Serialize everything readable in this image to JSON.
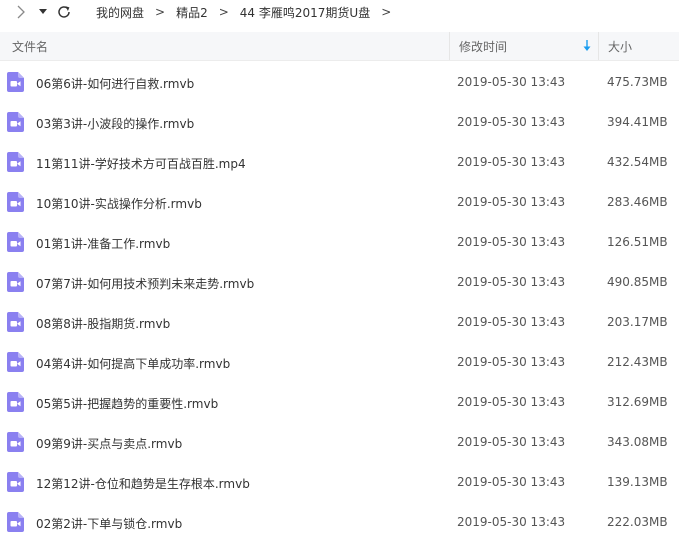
{
  "breadcrumb": [
    "我的网盘",
    "精品2",
    "44 李雁鸣2017期货U盘"
  ],
  "breadcrumb_separator": ">",
  "columns": {
    "name": "文件名",
    "modified": "修改时间",
    "size": "大小"
  },
  "colors": {
    "accent": "#1a9cf0",
    "file_icon": "#8a80f0",
    "header_bg": "#f6f7f9"
  },
  "icons": {
    "forward": "chevron-right-icon",
    "dropdown": "caret-down-icon",
    "refresh": "refresh-icon",
    "sort": "sort-down-arrow-icon",
    "file": "video-file-icon"
  },
  "files": [
    {
      "name": "06第6讲-如何进行自救.rmvb",
      "modified": "2019-05-30 13:43",
      "size": "475.73MB"
    },
    {
      "name": "03第3讲-小波段的操作.rmvb",
      "modified": "2019-05-30 13:43",
      "size": "394.41MB"
    },
    {
      "name": "11第11讲-学好技术方可百战百胜.mp4",
      "modified": "2019-05-30 13:43",
      "size": "432.54MB"
    },
    {
      "name": "10第10讲-实战操作分析.rmvb",
      "modified": "2019-05-30 13:43",
      "size": "283.46MB"
    },
    {
      "name": "01第1讲-准备工作.rmvb",
      "modified": "2019-05-30 13:43",
      "size": "126.51MB"
    },
    {
      "name": "07第7讲-如何用技术预判未来走势.rmvb",
      "modified": "2019-05-30 13:43",
      "size": "490.85MB"
    },
    {
      "name": "08第8讲-股指期货.rmvb",
      "modified": "2019-05-30 13:43",
      "size": "203.17MB"
    },
    {
      "name": "04第4讲-如何提高下单成功率.rmvb",
      "modified": "2019-05-30 13:43",
      "size": "212.43MB"
    },
    {
      "name": "05第5讲-把握趋势的重要性.rmvb",
      "modified": "2019-05-30 13:43",
      "size": "312.69MB"
    },
    {
      "name": "09第9讲-买点与卖点.rmvb",
      "modified": "2019-05-30 13:43",
      "size": "343.08MB"
    },
    {
      "name": "12第12讲-仓位和趋势是生存根本.rmvb",
      "modified": "2019-05-30 13:43",
      "size": "139.13MB"
    },
    {
      "name": "02第2讲-下单与锁仓.rmvb",
      "modified": "2019-05-30 13:43",
      "size": "222.03MB"
    }
  ]
}
